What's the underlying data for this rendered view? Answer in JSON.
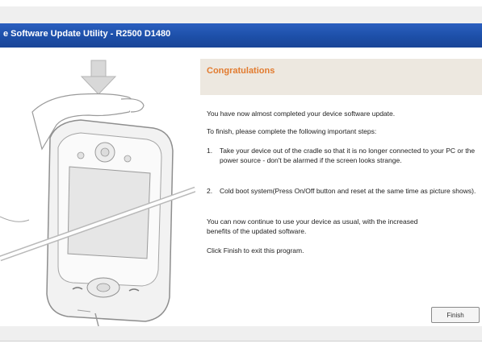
{
  "window": {
    "title": "e Software Update Utility -  R2500  D1480"
  },
  "header": {
    "title": "Congratulations"
  },
  "body": {
    "intro": "You have now almost completed your device software update.",
    "finish_prompt": "To finish, please complete the following important steps:",
    "steps": [
      {
        "num": "1.",
        "text": "Take your device out of the cradle so that it is no longer connected to your PC or the power source - don't be alarmed if the screen looks strange."
      },
      {
        "num": "2.",
        "text": "Cold boot system(Press On/Off button and reset at the same time as picture shows)."
      }
    ],
    "continue_text_1": "You can now continue to use your device as usual, with the increased",
    "continue_text_2": "benefits of the updated software.",
    "exit_text": "Click Finish to exit this program."
  },
  "buttons": {
    "finish": "Finish"
  },
  "colors": {
    "titlebar": "#1d4fa8",
    "header_title": "#e27b2f",
    "header_band": "#ede8e0"
  }
}
